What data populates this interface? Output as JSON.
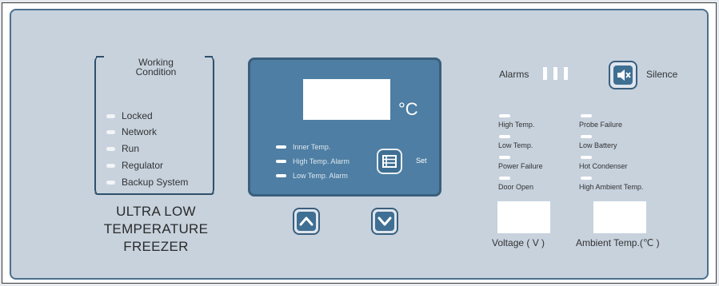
{
  "working_condition": {
    "title_line1": "Working",
    "title_line2": "Condition",
    "items": [
      {
        "label": "Locked"
      },
      {
        "label": "Network"
      },
      {
        "label": "Run"
      },
      {
        "label": "Regulator"
      },
      {
        "label": "Backup System"
      }
    ]
  },
  "product_title": {
    "line1": "ULTRA LOW",
    "line2": "TEMPERATURE",
    "line3": "FREEZER"
  },
  "display": {
    "unit": "°C",
    "indicators": [
      {
        "label": "Inner Temp."
      },
      {
        "label": "High Temp. Alarm"
      },
      {
        "label": "Low Temp. Alarm"
      }
    ],
    "set_label": "Set"
  },
  "alarms": {
    "label": "Alarms",
    "silence_label": "Silence"
  },
  "status_left": [
    {
      "label": "High Temp."
    },
    {
      "label": "Low Temp."
    },
    {
      "label": "Power Failure"
    },
    {
      "label": "Door Open"
    }
  ],
  "status_right": [
    {
      "label": "Probe Failure"
    },
    {
      "label": "Low Battery"
    },
    {
      "label": "Hot Condenser"
    },
    {
      "label": "High Ambient Temp."
    }
  ],
  "meters": {
    "voltage_label": "Voltage ( V )",
    "ambient_label": "Ambient Temp.(℃ )"
  },
  "colors": {
    "panel": "#c7d2dd",
    "display": "#4e7ea3",
    "border": "#3a5f7d",
    "led": "#ffffff"
  }
}
